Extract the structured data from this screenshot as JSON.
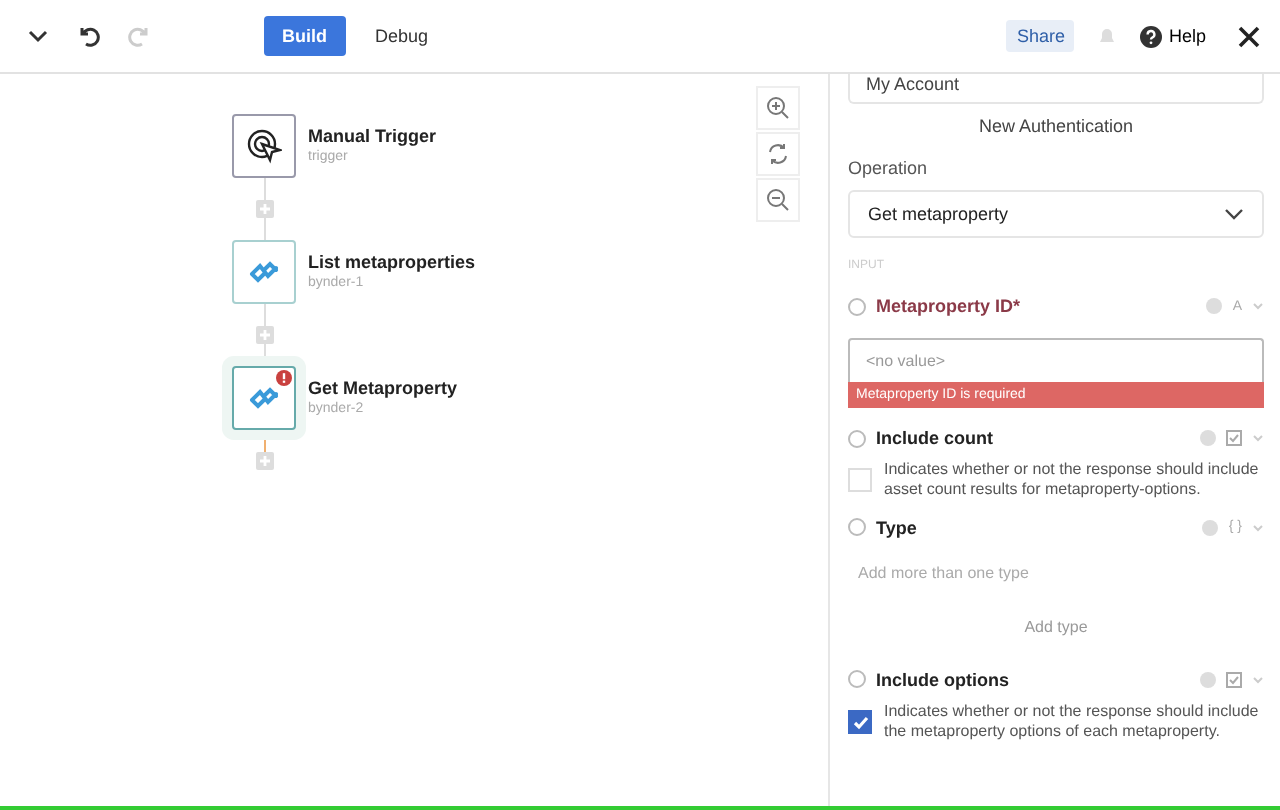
{
  "toolbar": {
    "tabs": [
      {
        "label": "Build",
        "selected": true
      },
      {
        "label": "Debug",
        "selected": false
      }
    ],
    "share": "Share",
    "help": "Help"
  },
  "workflow": {
    "steps": [
      {
        "kind": "trigger",
        "title": "Manual Trigger",
        "subtitle": "trigger",
        "error": false,
        "selected": false
      },
      {
        "kind": "bynder",
        "title": "List metaproperties",
        "subtitle": "bynder-1",
        "error": false,
        "selected": false
      },
      {
        "kind": "bynder",
        "title": "Get Metaproperty",
        "subtitle": "bynder-2",
        "error": true,
        "selected": true
      }
    ]
  },
  "panel": {
    "account": "My Account",
    "new_auth": "New Authentication",
    "operation": {
      "label": "Operation",
      "value": "Get metaproperty"
    },
    "section": "INPUT",
    "fields": [
      {
        "kind": "text",
        "label": "Metaproperty ID*",
        "required": true,
        "type_glyph": "A",
        "placeholder": "<no value>",
        "error": "Metaproperty ID is required"
      },
      {
        "kind": "boolean",
        "label": "Include count",
        "required": false,
        "checked": false,
        "description": "Indicates whether or not the response should include asset count results for metaproperty-options."
      },
      {
        "kind": "list",
        "label": "Type",
        "required": false,
        "type_glyph": "{ }",
        "placeholder": "Add more than one type",
        "add_label": "Add type"
      },
      {
        "kind": "boolean",
        "label": "Include options",
        "required": false,
        "checked": true,
        "description": "Indicates whether or not the response should include the metaproperty options of each metaproperty."
      }
    ]
  }
}
